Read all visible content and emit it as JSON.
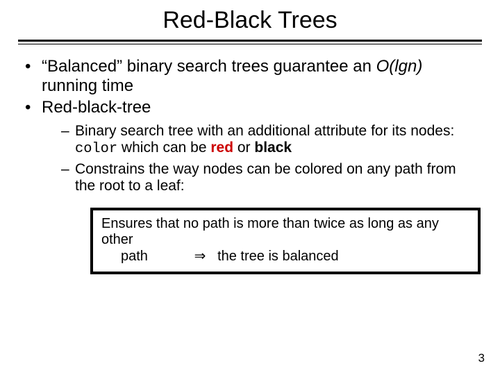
{
  "title": "Red-Black Trees",
  "bullets": {
    "b1_pre": "“Balanced” binary search trees guarantee an ",
    "b1_big": "O(lgn)",
    "b1_post": " running time",
    "b2": "Red-black-tree",
    "sub1_pre": "Binary search tree with an additional attribute for its nodes: ",
    "sub1_color_word": "color",
    "sub1_mid": " which can be ",
    "sub1_red": "red",
    "sub1_or": " or ",
    "sub1_black": "black",
    "sub2": "Constrains the way nodes can be colored on any path from the root to a leaf:"
  },
  "callout": {
    "line1": "Ensures that no path is more than twice as long as any other",
    "line2_pre": "path",
    "line2_arrow": "⇒",
    "line2_post": "the tree is balanced"
  },
  "page_number": "3"
}
